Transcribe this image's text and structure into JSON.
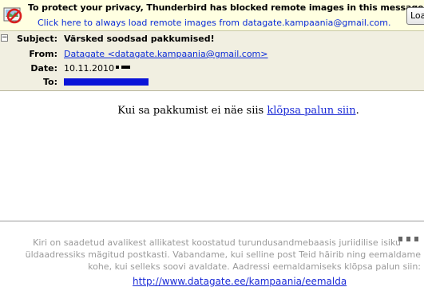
{
  "privacy_bar": {
    "title": "To protect your privacy, Thunderbird has blocked remote images in this message.",
    "link": "Click here to always load remote images from datagate.kampaania@gmail.com.",
    "load_button": "Load Images",
    "icon": "blocked-image-icon"
  },
  "header": {
    "subject_label": "Subject:",
    "subject_value": "Värsked soodsad pakkumised!",
    "from_label": "From:",
    "from_value": "Datagate <datagate.kampaania@gmail.com>",
    "date_label": "Date:",
    "date_value": "10.11.2010",
    "to_label": "To:",
    "toggle_icon": "collapse-minus-icon"
  },
  "body": {
    "text": "Kui sa pakkumist ei näe siis",
    "link": "klõpsa palun siin",
    "trailing": "."
  },
  "footer": {
    "lines": [
      "Kiri on saadetud avalikest allikatest koostatud turundusandmebaasis juriidilise isiku",
      "üldaadressiks mägitud postkasti. Vabandame, kui selline post Teid häirib ning eemaldame",
      "kohe, kui selleks soovi avaldate. Aadressi eemaldamiseks klõpsa palun siin:"
    ],
    "unsubscribe_link": "http://www.datagate.ee/kampaania/eemalda"
  }
}
